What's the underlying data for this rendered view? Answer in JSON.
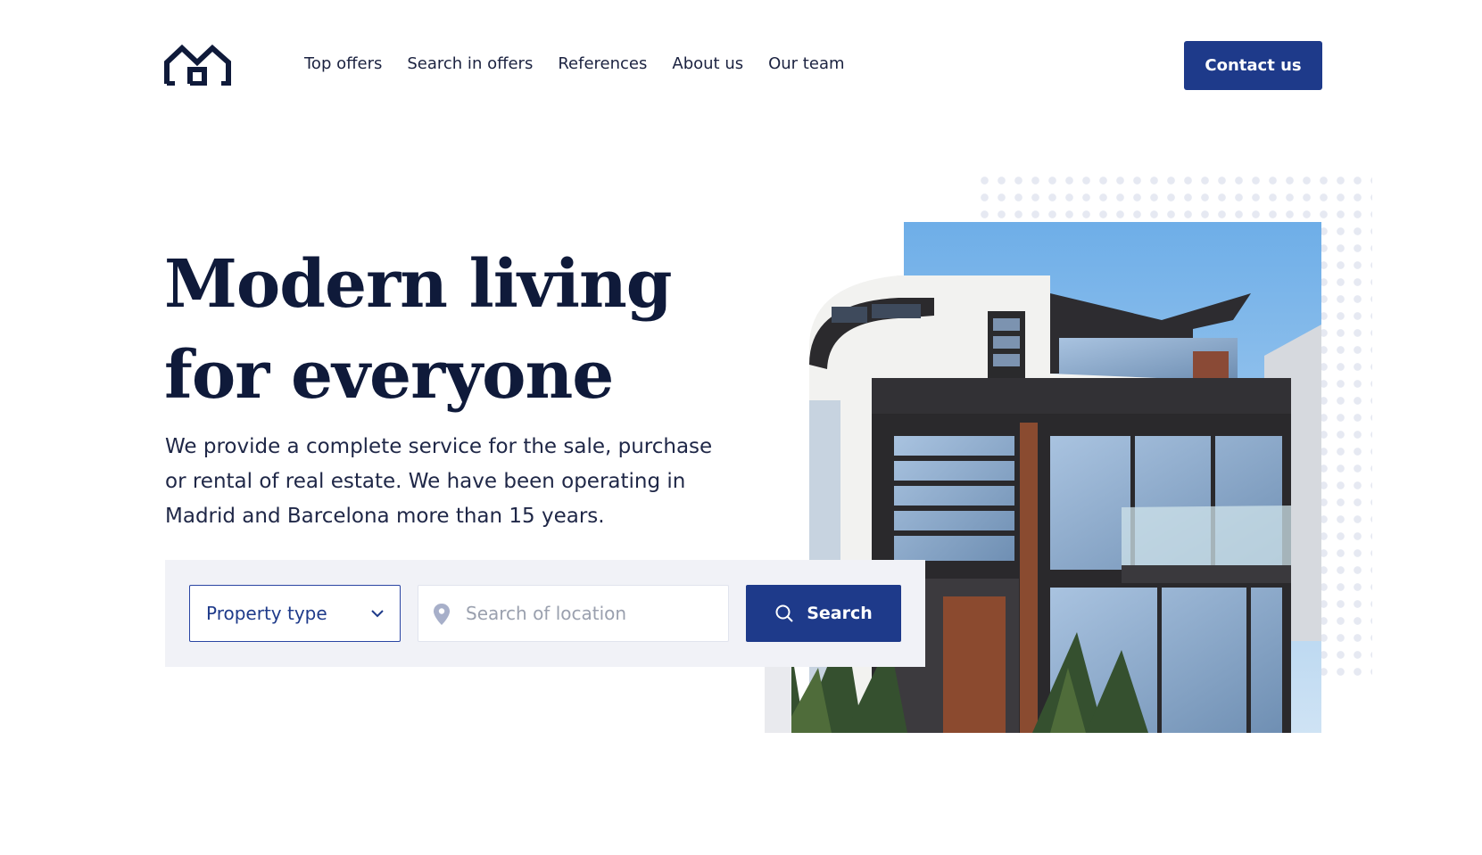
{
  "header": {
    "logo_icon": "house-logo-icon",
    "nav": [
      "Top offers",
      "Search in offers",
      "References",
      "About us",
      "Our team"
    ],
    "contact_label": "Contact us"
  },
  "hero": {
    "title_line1": "Modern living",
    "title_line2": "for everyone",
    "description": "We provide a complete service for the sale, purchase or rental of real estate. We have been operating in Madrid and Barcelona more than 15 years."
  },
  "search": {
    "property_type_label": "Property type",
    "location_placeholder": "Search of location",
    "search_label": "Search"
  },
  "colors": {
    "primary": "#1e3a8a",
    "heading": "#0f1a3a",
    "panel": "#f1f2f7"
  }
}
